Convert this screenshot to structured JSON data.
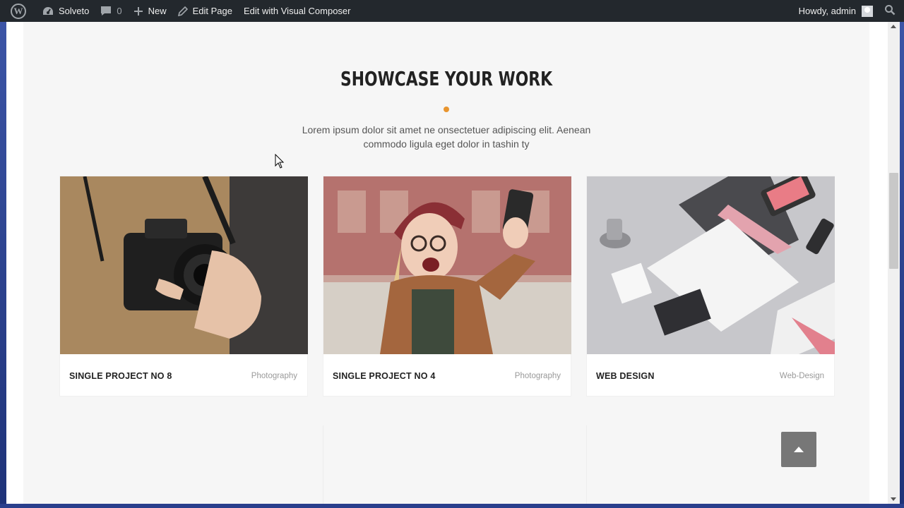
{
  "adminbar": {
    "site_name": "Solveto",
    "comments_count": "0",
    "new_label": "New",
    "edit_page_label": "Edit Page",
    "edit_vc_label": "Edit with Visual Composer",
    "greeting": "Howdy, admin"
  },
  "section": {
    "title": "SHOWCASE YOUR WORK",
    "intro": "Lorem ipsum dolor sit amet ne onsectetuer adipiscing elit. Aenean commodo ligula eget dolor in tashin ty",
    "accent_color": "#e8952f"
  },
  "projects": [
    {
      "title": "SINGLE PROJECT NO 8",
      "category": "Photography"
    },
    {
      "title": "SINGLE PROJECT NO 4",
      "category": "Photography"
    },
    {
      "title": "WEB DESIGN",
      "category": "Web-Design"
    }
  ],
  "icons": {
    "wp": "wordpress-logo-icon",
    "site": "dashboard-icon",
    "comments": "comment-icon",
    "new": "plus-icon",
    "edit": "pencil-icon",
    "search": "search-icon",
    "scroll_top": "arrow-up-icon"
  }
}
